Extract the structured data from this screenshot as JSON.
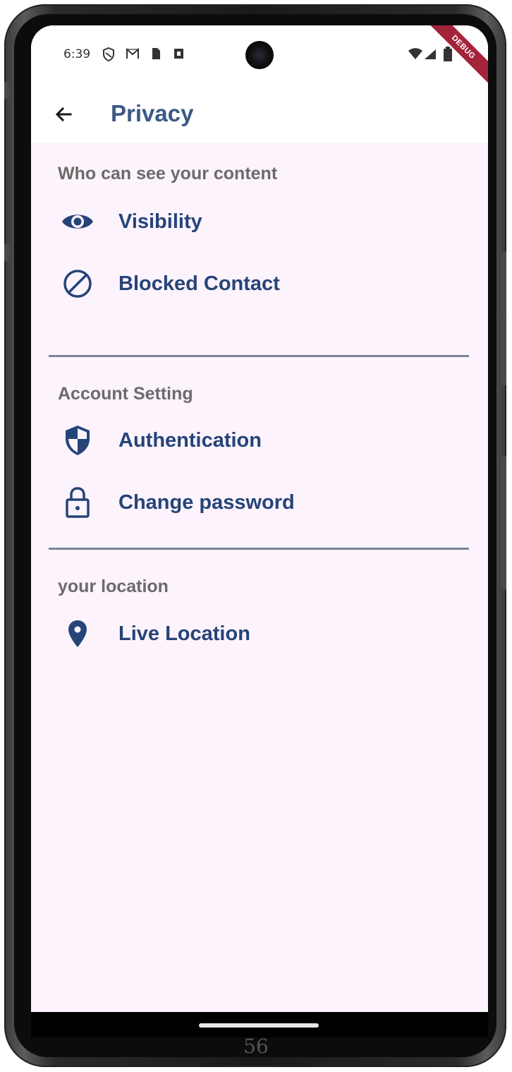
{
  "status_bar": {
    "time": "6:39",
    "icons": [
      "shield-icon",
      "gmail-icon",
      "sim-icon",
      "square-icon",
      "wifi-icon",
      "signal-icon",
      "battery-icon"
    ]
  },
  "debug_banner": "DEBUG",
  "app_bar": {
    "back_icon": "arrow-back-icon",
    "title": "Privacy"
  },
  "sections": [
    {
      "header": "Who can see your content",
      "items": [
        {
          "icon": "eye-icon",
          "label": "Visibility"
        },
        {
          "icon": "block-icon",
          "label": "Blocked Contact"
        }
      ]
    },
    {
      "header": "Account Setting",
      "items": [
        {
          "icon": "shield-icon",
          "label": "Authentication"
        },
        {
          "icon": "lock-icon",
          "label": "Change password"
        }
      ]
    },
    {
      "header": "your location",
      "items": [
        {
          "icon": "location-pin-icon",
          "label": "Live Location"
        }
      ]
    }
  ],
  "colors": {
    "title": "#3c5a84",
    "item_text": "#264478",
    "section_header": "#6b6b6b",
    "background": "#fcf3fc",
    "divider": "#7a8499",
    "debug_ribbon": "#a3243a"
  },
  "page_number": "56"
}
